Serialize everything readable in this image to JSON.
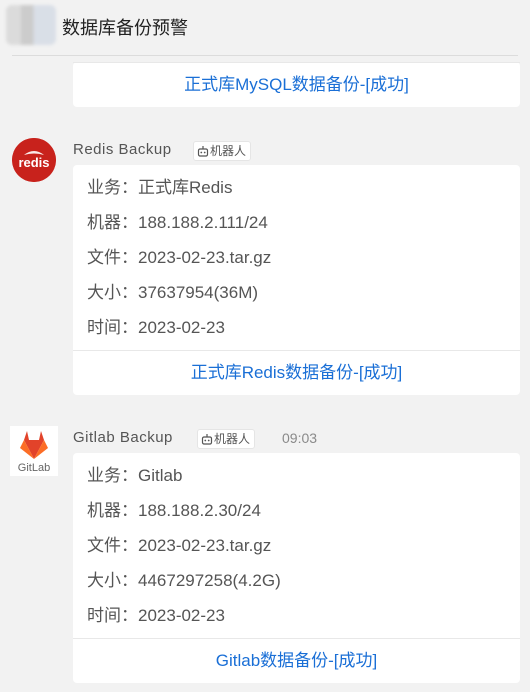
{
  "header": {
    "title": "数据库备份预警"
  },
  "messages": [
    {
      "footer": "正式库MySQL数据备份-[成功]"
    },
    {
      "sender": "Redis  Backup",
      "bot_label": "机器人",
      "avatar_text": "redis",
      "lines": [
        {
          "key": "业务：",
          "value": "正式库Redis"
        },
        {
          "key": "机器：",
          "value": "188.188.2.111/24"
        },
        {
          "key": "文件：",
          "value": "2023-02-23.tar.gz"
        },
        {
          "key": "大小：",
          "value": "37637954(36M)"
        },
        {
          "key": "时间：",
          "value": "2023-02-23"
        }
      ],
      "footer": "正式库Redis数据备份-[成功]"
    },
    {
      "sender": "Gitlab  Backup",
      "bot_label": "机器人",
      "time": "09:03",
      "avatar_text": "GitLab",
      "lines": [
        {
          "key": "业务：",
          "value": "Gitlab"
        },
        {
          "key": "机器：",
          "value": "188.188.2.30/24"
        },
        {
          "key": "文件：",
          "value": "2023-02-23.tar.gz"
        },
        {
          "key": "大小：",
          "value": "4467297258(4.2G)"
        },
        {
          "key": "时间：",
          "value": "2023-02-23"
        }
      ],
      "footer": "Gitlab数据备份-[成功]"
    }
  ],
  "colors": {
    "link": "#1a6fd6",
    "redis_red": "#c8221c",
    "gitlab_orange": "#e2432a"
  }
}
